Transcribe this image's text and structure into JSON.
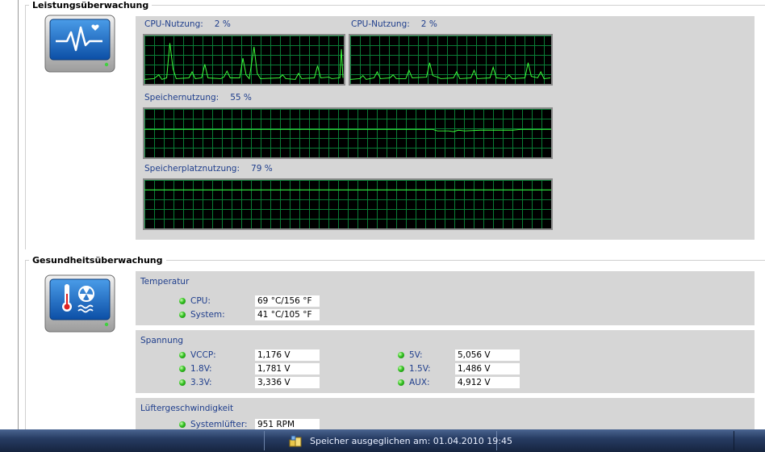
{
  "performance": {
    "legend": "Leistungsüberwachung",
    "cpu1": {
      "label": "CPU-Nutzung:",
      "value": "2 %"
    },
    "cpu2": {
      "label": "CPU-Nutzung:",
      "value": "2 %"
    },
    "memory": {
      "label": "Speichernutzung:",
      "value": "55 %"
    },
    "disk": {
      "label": "Speicherplatznutzung:",
      "value": "79 %"
    }
  },
  "health": {
    "legend": "Gesundheitsüberwachung",
    "temperature": {
      "title": "Temperatur",
      "cpu": {
        "label": "CPU:",
        "value": "69 °C/156 °F"
      },
      "system": {
        "label": "System:",
        "value": "41 °C/105 °F"
      }
    },
    "voltage": {
      "title": "Spannung",
      "vccp": {
        "label": "VCCP:",
        "value": "1,176 V"
      },
      "v18": {
        "label": "1.8V:",
        "value": "1,781 V"
      },
      "v33": {
        "label": "3.3V:",
        "value": "3,336 V"
      },
      "v5": {
        "label": "5V:",
        "value": "5,056 V"
      },
      "v15": {
        "label": "1.5V:",
        "value": "1,486 V"
      },
      "aux": {
        "label": "AUX:",
        "value": "4,912 V"
      }
    },
    "fan": {
      "title": "Lüftergeschwindigkeit",
      "system": {
        "label": "Systemlüfter:",
        "value": "951 RPM"
      }
    }
  },
  "taskbar": {
    "status": "Speicher ausgeglichen am: 01.04.2010 19:45"
  },
  "colors": {
    "graph_line": "#3cff3c",
    "graph_grid": "#0a7d36",
    "label_blue": "#1f3e8c",
    "panel_gray": "#d6d6d6",
    "status_dot": "#32c020"
  }
}
